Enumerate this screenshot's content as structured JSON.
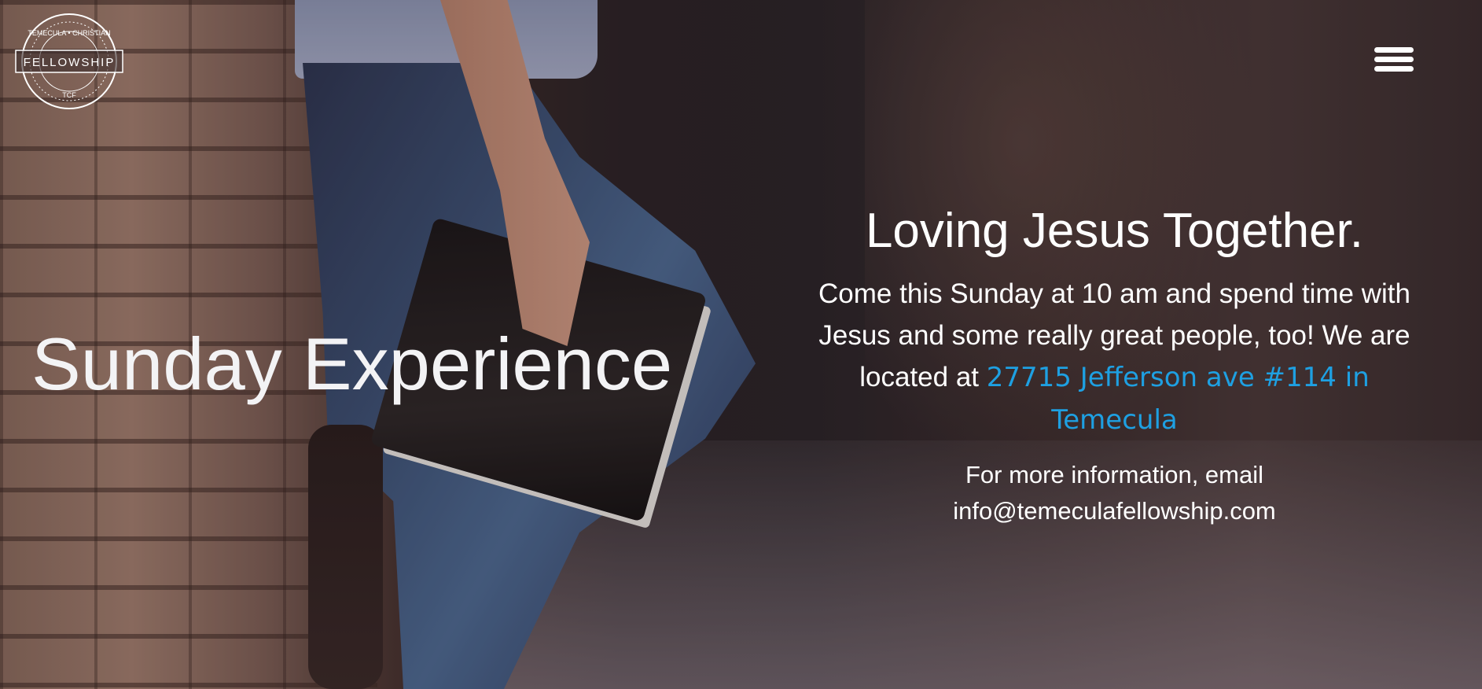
{
  "header": {
    "logo": {
      "top_text": "TEMECULA • CHRISTIAN",
      "center_text": "FELLOWSHIP",
      "bottom_text": "TCF"
    },
    "menu_icon": "hamburger-menu-icon"
  },
  "hero": {
    "title": "Sunday Experience"
  },
  "info": {
    "heading": "Loving Jesus Together.",
    "body_text": "Come this Sunday at 10 am and spend time with Jesus and some really great people, too! We are located at",
    "address_link": "27715 Jefferson ave #114 in Temecula",
    "contact_line_1": "For more information, email",
    "contact_email": "info@temeculafellowship.com"
  },
  "colors": {
    "link": "#1ea0e2",
    "text": "#ffffff"
  }
}
